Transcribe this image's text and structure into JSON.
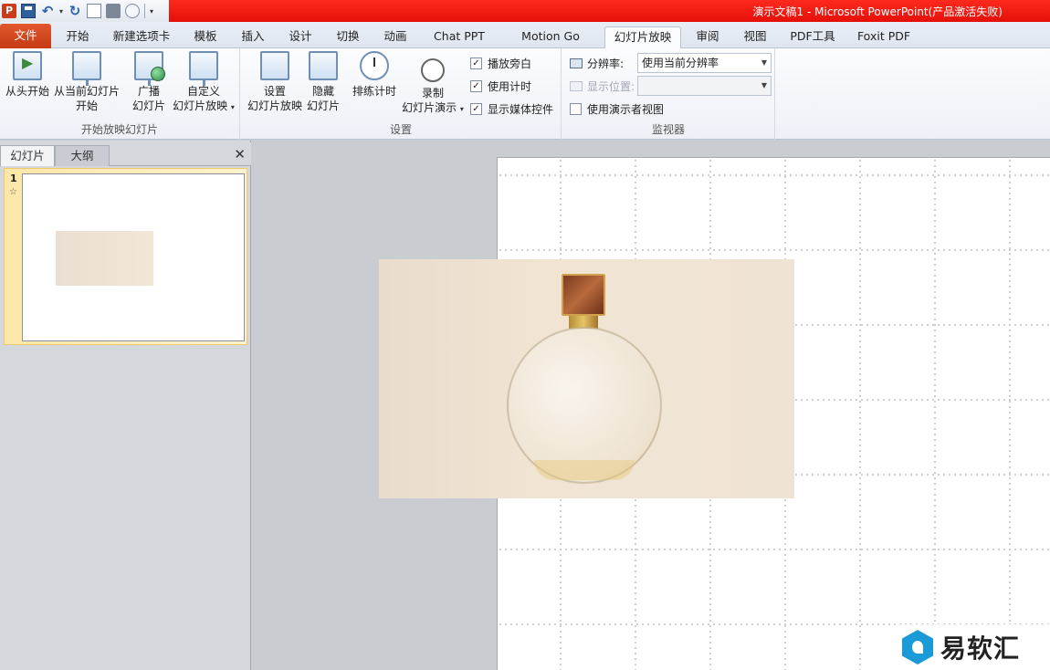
{
  "window": {
    "title": "演示文稿1 - Microsoft PowerPoint(产品激活失败)",
    "app_icon_letter": "P"
  },
  "tabs": [
    {
      "label": "文件"
    },
    {
      "label": "开始"
    },
    {
      "label": "新建选项卡"
    },
    {
      "label": "模板"
    },
    {
      "label": "插入"
    },
    {
      "label": "设计"
    },
    {
      "label": "切换"
    },
    {
      "label": "动画"
    },
    {
      "label": "Chat PPT"
    },
    {
      "label": "Motion Go"
    },
    {
      "label": "幻灯片放映"
    },
    {
      "label": "审阅"
    },
    {
      "label": "视图"
    },
    {
      "label": "PDF工具"
    },
    {
      "label": "Foxit PDF"
    }
  ],
  "ribbon": {
    "start_group": {
      "label": "开始放映幻灯片",
      "from_beginning": "从头开始",
      "from_current_1": "从当前幻灯片",
      "from_current_2": "开始",
      "broadcast_1": "广播",
      "broadcast_2": "幻灯片",
      "custom_1": "自定义",
      "custom_2": "幻灯片放映"
    },
    "setup_group": {
      "label": "设置",
      "setup_1": "设置",
      "setup_2": "幻灯片放映",
      "hide_1": "隐藏",
      "hide_2": "幻灯片",
      "rehearse": "排练计时",
      "record_1": "录制",
      "record_2": "幻灯片演示",
      "check_narration": "播放旁白",
      "check_timings": "使用计时",
      "check_media": "显示媒体控件"
    },
    "monitor_group": {
      "label": "监视器",
      "resolution_label": "分辨率:",
      "resolution_value": "使用当前分辨率",
      "display_label": "显示位置:",
      "display_value": "",
      "presenter_view": "使用演示者视图"
    }
  },
  "left_panel": {
    "tab_slides": "幻灯片",
    "tab_outline": "大纲",
    "slide_number": "1",
    "slide_star": "☆"
  },
  "watermark": {
    "text": "易软汇"
  }
}
